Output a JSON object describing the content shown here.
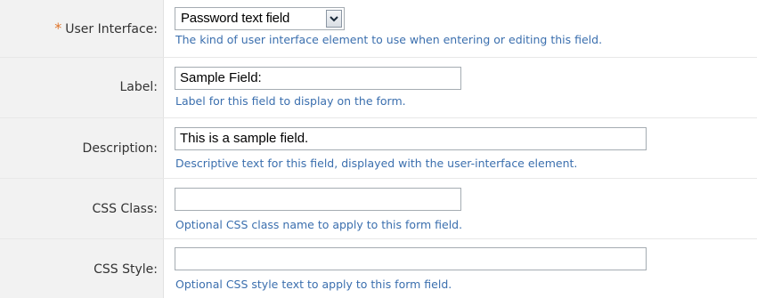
{
  "fields": [
    {
      "label": "User Interface:",
      "required_marker": "*",
      "selected_option": "Password text field",
      "help": "The kind of user interface element to use when entering or editing this field."
    },
    {
      "label": "Label:",
      "value": "Sample Field:",
      "help": "Label for this field to display on the form."
    },
    {
      "label": "Description:",
      "value": "This is a sample field.",
      "help": "Descriptive text for this field, displayed with the user-interface element."
    },
    {
      "label": "CSS Class:",
      "value": "",
      "help": "Optional CSS class name to apply to this form field."
    },
    {
      "label": "CSS Style:",
      "value": "",
      "help": "Optional CSS style text to apply to this form field."
    }
  ],
  "colors": {
    "help_text": "#3b6fae",
    "required_marker": "#e0742a",
    "label_background": "#f2f2f2"
  },
  "icons": {
    "select_arrow": "chevron-down-icon"
  }
}
